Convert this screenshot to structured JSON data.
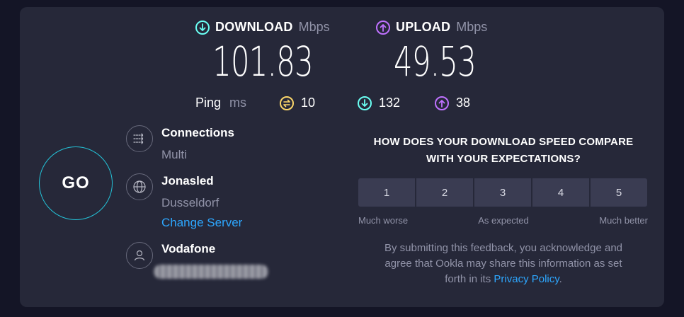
{
  "download": {
    "label": "DOWNLOAD",
    "unit": "Mbps",
    "value": "101.83",
    "color": "#6afff3"
  },
  "upload": {
    "label": "UPLOAD",
    "unit": "Mbps",
    "value": "49.53",
    "color": "#bf71ff"
  },
  "ping": {
    "label": "Ping",
    "unit": "ms",
    "idle": "10",
    "download": "132",
    "upload": "38",
    "idle_color": "#fbd66a"
  },
  "go_button": {
    "label": "GO",
    "color": "#24c3d8"
  },
  "connections": {
    "title": "Connections",
    "value": "Multi"
  },
  "server": {
    "name": "Jonasled",
    "location": "Dusseldorf",
    "change_link": "Change Server"
  },
  "provider": {
    "name": "Vodafone"
  },
  "survey": {
    "question_line1": "HOW DOES YOUR DOWNLOAD SPEED COMPARE",
    "question_line2": "WITH YOUR EXPECTATIONS?",
    "options": [
      "1",
      "2",
      "3",
      "4",
      "5"
    ],
    "scale_low": "Much worse",
    "scale_mid": "As expected",
    "scale_high": "Much better",
    "note_line1": "By submitting this feedback, you acknowledge and",
    "note_line2": "agree that Ookla may share this information as set",
    "note_line3_prefix": "forth in its ",
    "privacy_link": "Privacy Policy",
    "note_line3_suffix": "."
  }
}
